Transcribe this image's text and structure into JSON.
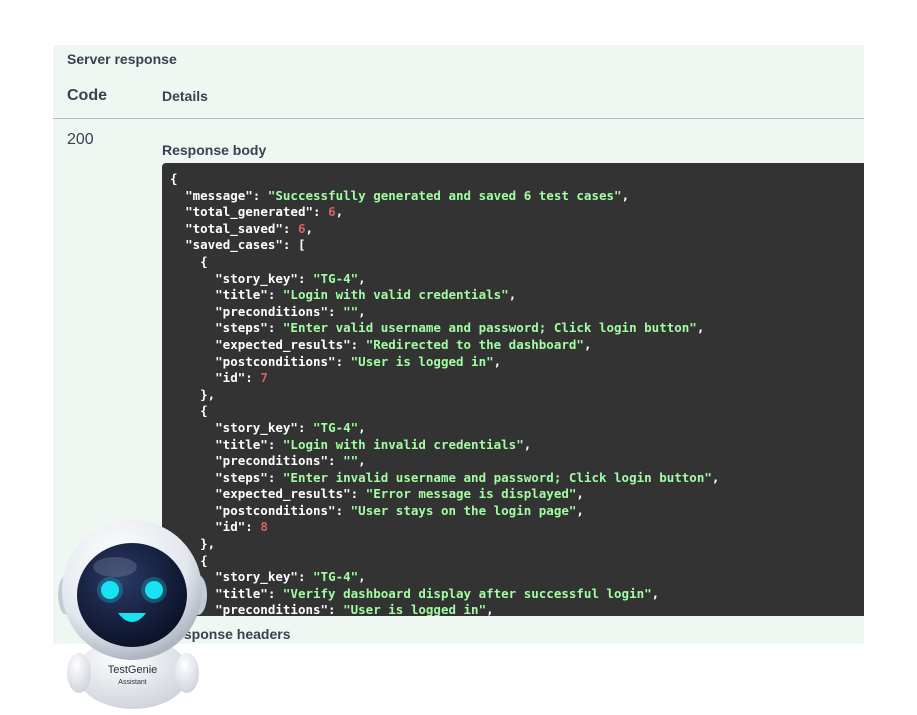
{
  "server_response": {
    "title": "Server response",
    "col_code": "Code",
    "col_details": "Details",
    "code": "200",
    "response_body_title": "Response body",
    "response_headers_title": "Response headers"
  },
  "response_body": {
    "lines": [
      [
        {
          "t": "p",
          "v": "{"
        }
      ],
      [
        {
          "t": "p",
          "v": "  "
        },
        {
          "t": "k",
          "v": "\"message\""
        },
        {
          "t": "p",
          "v": ": "
        },
        {
          "t": "s",
          "v": "\"Successfully generated and saved 6 test cases\""
        },
        {
          "t": "p",
          "v": ","
        }
      ],
      [
        {
          "t": "p",
          "v": "  "
        },
        {
          "t": "k",
          "v": "\"total_generated\""
        },
        {
          "t": "p",
          "v": ": "
        },
        {
          "t": "n",
          "v": "6"
        },
        {
          "t": "p",
          "v": ","
        }
      ],
      [
        {
          "t": "p",
          "v": "  "
        },
        {
          "t": "k",
          "v": "\"total_saved\""
        },
        {
          "t": "p",
          "v": ": "
        },
        {
          "t": "n",
          "v": "6"
        },
        {
          "t": "p",
          "v": ","
        }
      ],
      [
        {
          "t": "p",
          "v": "  "
        },
        {
          "t": "k",
          "v": "\"saved_cases\""
        },
        {
          "t": "p",
          "v": ": ["
        }
      ],
      [
        {
          "t": "p",
          "v": "    {"
        }
      ],
      [
        {
          "t": "p",
          "v": "      "
        },
        {
          "t": "k",
          "v": "\"story_key\""
        },
        {
          "t": "p",
          "v": ": "
        },
        {
          "t": "s",
          "v": "\"TG-4\""
        },
        {
          "t": "p",
          "v": ","
        }
      ],
      [
        {
          "t": "p",
          "v": "      "
        },
        {
          "t": "k",
          "v": "\"title\""
        },
        {
          "t": "p",
          "v": ": "
        },
        {
          "t": "s",
          "v": "\"Login with valid credentials\""
        },
        {
          "t": "p",
          "v": ","
        }
      ],
      [
        {
          "t": "p",
          "v": "      "
        },
        {
          "t": "k",
          "v": "\"preconditions\""
        },
        {
          "t": "p",
          "v": ": "
        },
        {
          "t": "s",
          "v": "\"\""
        },
        {
          "t": "p",
          "v": ","
        }
      ],
      [
        {
          "t": "p",
          "v": "      "
        },
        {
          "t": "k",
          "v": "\"steps\""
        },
        {
          "t": "p",
          "v": ": "
        },
        {
          "t": "s",
          "v": "\"Enter valid username and password; Click login button\""
        },
        {
          "t": "p",
          "v": ","
        }
      ],
      [
        {
          "t": "p",
          "v": "      "
        },
        {
          "t": "k",
          "v": "\"expected_results\""
        },
        {
          "t": "p",
          "v": ": "
        },
        {
          "t": "s",
          "v": "\"Redirected to the dashboard\""
        },
        {
          "t": "p",
          "v": ","
        }
      ],
      [
        {
          "t": "p",
          "v": "      "
        },
        {
          "t": "k",
          "v": "\"postconditions\""
        },
        {
          "t": "p",
          "v": ": "
        },
        {
          "t": "s",
          "v": "\"User is logged in\""
        },
        {
          "t": "p",
          "v": ","
        }
      ],
      [
        {
          "t": "p",
          "v": "      "
        },
        {
          "t": "k",
          "v": "\"id\""
        },
        {
          "t": "p",
          "v": ": "
        },
        {
          "t": "n",
          "v": "7"
        }
      ],
      [
        {
          "t": "p",
          "v": "    },"
        }
      ],
      [
        {
          "t": "p",
          "v": "    {"
        }
      ],
      [
        {
          "t": "p",
          "v": "      "
        },
        {
          "t": "k",
          "v": "\"story_key\""
        },
        {
          "t": "p",
          "v": ": "
        },
        {
          "t": "s",
          "v": "\"TG-4\""
        },
        {
          "t": "p",
          "v": ","
        }
      ],
      [
        {
          "t": "p",
          "v": "      "
        },
        {
          "t": "k",
          "v": "\"title\""
        },
        {
          "t": "p",
          "v": ": "
        },
        {
          "t": "s",
          "v": "\"Login with invalid credentials\""
        },
        {
          "t": "p",
          "v": ","
        }
      ],
      [
        {
          "t": "p",
          "v": "      "
        },
        {
          "t": "k",
          "v": "\"preconditions\""
        },
        {
          "t": "p",
          "v": ": "
        },
        {
          "t": "s",
          "v": "\"\""
        },
        {
          "t": "p",
          "v": ","
        }
      ],
      [
        {
          "t": "p",
          "v": "      "
        },
        {
          "t": "k",
          "v": "\"steps\""
        },
        {
          "t": "p",
          "v": ": "
        },
        {
          "t": "s",
          "v": "\"Enter invalid username and password; Click login button\""
        },
        {
          "t": "p",
          "v": ","
        }
      ],
      [
        {
          "t": "p",
          "v": "      "
        },
        {
          "t": "k",
          "v": "\"expected_results\""
        },
        {
          "t": "p",
          "v": ": "
        },
        {
          "t": "s",
          "v": "\"Error message is displayed\""
        },
        {
          "t": "p",
          "v": ","
        }
      ],
      [
        {
          "t": "p",
          "v": "      "
        },
        {
          "t": "k",
          "v": "\"postconditions\""
        },
        {
          "t": "p",
          "v": ": "
        },
        {
          "t": "s",
          "v": "\"User stays on the login page\""
        },
        {
          "t": "p",
          "v": ","
        }
      ],
      [
        {
          "t": "p",
          "v": "      "
        },
        {
          "t": "k",
          "v": "\"id\""
        },
        {
          "t": "p",
          "v": ": "
        },
        {
          "t": "n",
          "v": "8"
        }
      ],
      [
        {
          "t": "p",
          "v": "    },"
        }
      ],
      [
        {
          "t": "p",
          "v": "    {"
        }
      ],
      [
        {
          "t": "p",
          "v": "      "
        },
        {
          "t": "k",
          "v": "\"story_key\""
        },
        {
          "t": "p",
          "v": ": "
        },
        {
          "t": "s",
          "v": "\"TG-4\""
        },
        {
          "t": "p",
          "v": ","
        }
      ],
      [
        {
          "t": "p",
          "v": "      "
        },
        {
          "t": "k",
          "v": "\"title\""
        },
        {
          "t": "p",
          "v": ": "
        },
        {
          "t": "s",
          "v": "\"Verify dashboard display after successful login\""
        },
        {
          "t": "p",
          "v": ","
        }
      ],
      [
        {
          "t": "p",
          "v": "      "
        },
        {
          "t": "k",
          "v": "\"preconditions\""
        },
        {
          "t": "p",
          "v": ": "
        },
        {
          "t": "s",
          "v": "\"User is logged in\""
        },
        {
          "t": "p",
          "v": ","
        }
      ]
    ]
  },
  "assistant": {
    "name": "TestGenie",
    "subtitle": "Assistant",
    "icon": "robot-icon"
  },
  "colors": {
    "panel_bg": "#eef7f1",
    "code_bg": "#333333",
    "json_key": "#ffffff",
    "json_string": "#a2fca2",
    "json_number": "#d36363",
    "robot_eyes": "#19e3f2"
  }
}
